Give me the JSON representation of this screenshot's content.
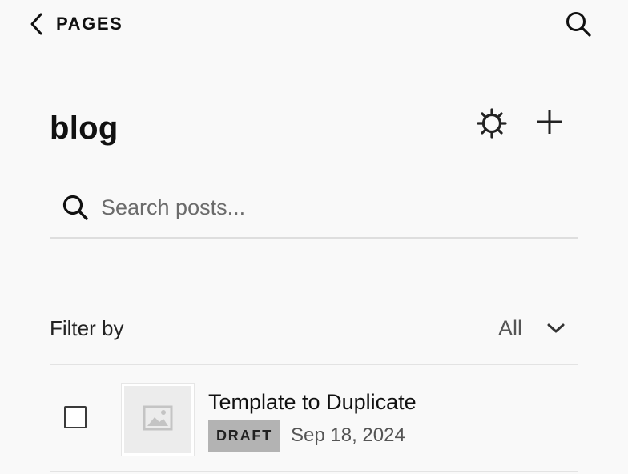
{
  "nav": {
    "back_label": "PAGES",
    "back_icon": "chevron-left-icon",
    "search_icon": "search-icon"
  },
  "page": {
    "title": "blog",
    "settings_icon": "gear-icon",
    "add_icon": "plus-icon"
  },
  "search": {
    "placeholder": "Search posts...",
    "value": "",
    "icon": "search-icon"
  },
  "filter": {
    "label": "Filter by",
    "selected": "All",
    "icon": "chevron-down-icon"
  },
  "posts": [
    {
      "title": "Template to Duplicate",
      "status": "DRAFT",
      "date": "Sep 18, 2024",
      "checked": false,
      "thumbnail_icon": "image-placeholder-icon"
    }
  ],
  "colors": {
    "background": "#f9f9f9",
    "text": "#111111",
    "muted_text": "#555555",
    "badge_bg": "#b3b3b3",
    "divider": "#e3e3e3"
  }
}
